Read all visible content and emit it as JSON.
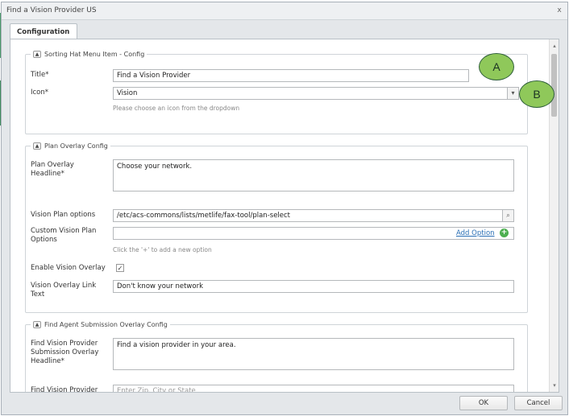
{
  "dialog": {
    "title": "Find a Vision Provider US",
    "close_glyph": "x"
  },
  "tabs": [
    {
      "label": "Configuration"
    }
  ],
  "sorting_hat": {
    "legend": "Sorting Hat Menu Item - Config",
    "title_label": "Title*",
    "title_value": "Find a Vision Provider",
    "icon_label": "Icon*",
    "icon_value": "Vision",
    "icon_hint": "Please choose an icon from the dropdown"
  },
  "plan_overlay": {
    "legend": "Plan Overlay Config",
    "headline_label": "Plan Overlay Headline*",
    "headline_value": "Choose your network.",
    "plan_options_label": "Vision Plan options",
    "plan_options_value": "/etc/acs-commons/lists/metlife/fax-tool/plan-select",
    "custom_options_label": "Custom Vision Plan Options",
    "custom_options_value": "",
    "add_option_label": "Add Option",
    "custom_options_hint": "Click the '+' to add a new option",
    "enable_overlay_label": "Enable Vision Overlay",
    "enable_overlay_checked": true,
    "overlay_link_label": "Vision Overlay Link Text",
    "overlay_link_value": "Don't know your network"
  },
  "agent_overlay": {
    "legend": "Find Agent Submission Overlay Config",
    "headline_label": "Find Vision Provider Submission Overlay Headline*",
    "headline_value": "Find a vision provider in your area.",
    "next_label": "Find Vision Provider",
    "next_value": "Enter Zip, City or State"
  },
  "callouts": [
    {
      "label": "A"
    },
    {
      "label": "B"
    }
  ],
  "footer": {
    "ok_label": "OK",
    "cancel_label": "Cancel"
  },
  "colors": {
    "callout_fill": "#8fc85a",
    "callout_border": "#2f5f3a",
    "link_blue": "#2a6fb5",
    "add_icon_green": "#4caf50",
    "side_strip_green": "#4a9a6a"
  },
  "icons": {
    "dropdown": "chevron-down-icon",
    "browse": "search-icon",
    "add": "plus-icon",
    "collapse": "collapse-icon",
    "check": "checkmark-icon"
  }
}
